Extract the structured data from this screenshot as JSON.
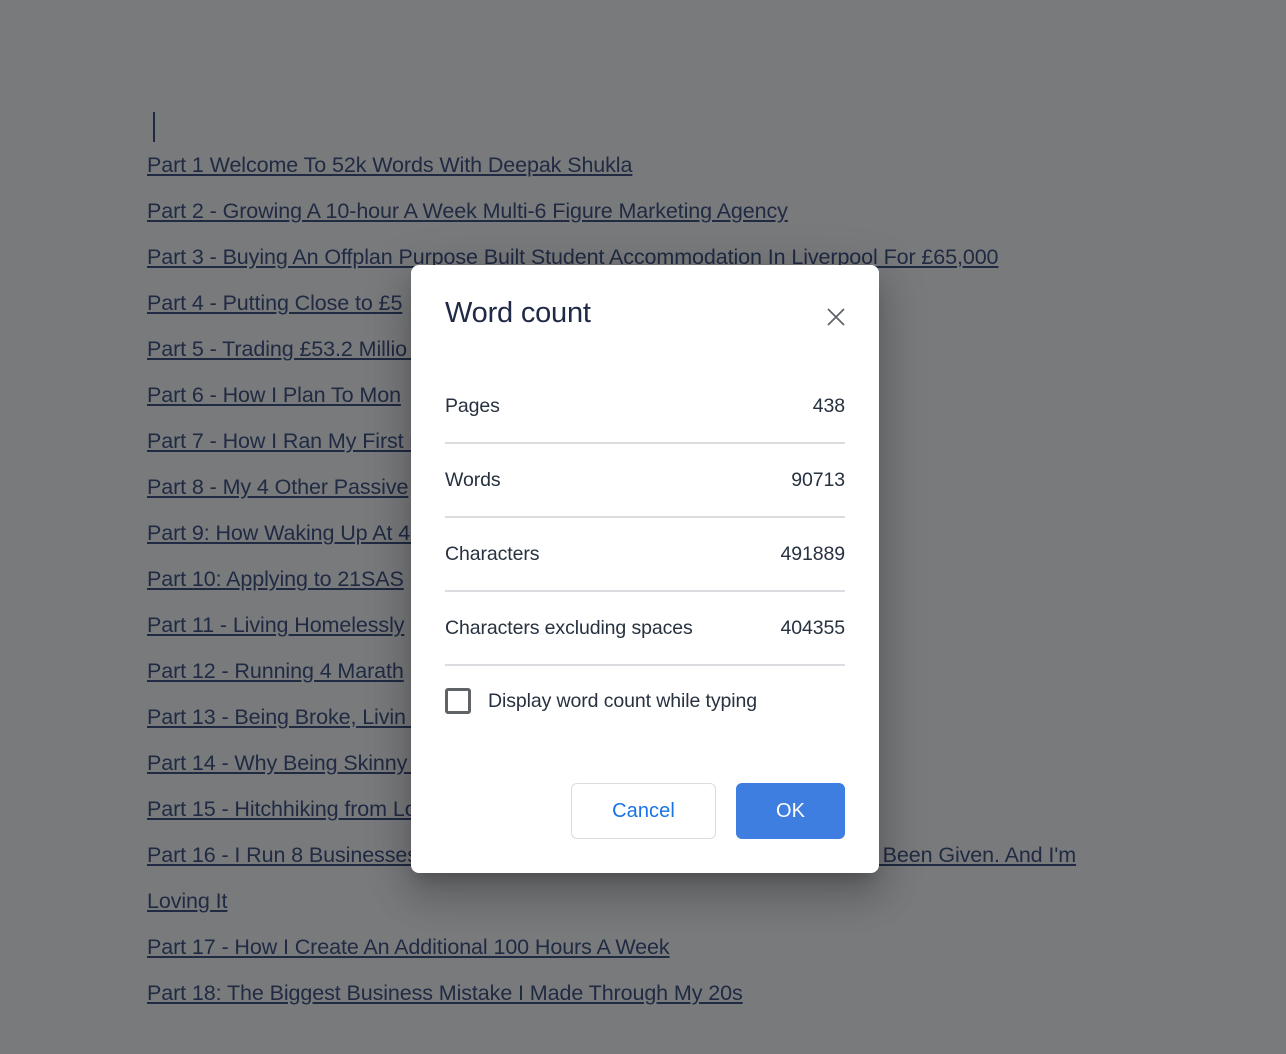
{
  "document": {
    "caret_visible": true,
    "links": [
      "Part 1 Welcome To 52k Words With Deepak Shukla",
      "Part 2 - Growing A 10-hour A Week Multi-6 Figure Marketing Agency",
      "Part 3 - Buying An Offplan Purpose Built Student Accommodation In Liverpool For £65,000",
      "Part 4 - Putting Close to £5                                                  ",
      "Part 5 - Trading £53.2 Millio                                             sh",
      "Part 6 - How I Plan To Mon                                             ",
      "Part 7 - How I Ran My First                                       ning 3 miles",
      "Part 8 - My 4 Other Passive                                        ",
      "Part 9: How Waking Up At 4                                        My Life",
      "Part 10: Applying to 21SAS                                       ",
      "Part 11 - Living Homelessly                                       ",
      "Part 12 - Running 4 Marath                                        ",
      "Part 13 - Being Broke, Livin                                            On An Estate In London",
      "Part 14 - Why Being Skinny                                           e Best Thing That Ever Happened To Me",
      "Part 15 - Hitchhiking from London to Estonia, Tallinn For A Stag Do",
      "Part 16 - I Run 8 Businesses At Once. It's The Opposite Of All The Advice I've Been Given. And I'm Loving It",
      "Part 17 - How I Create An Additional 100 Hours A Week",
      "Part 18: The Biggest Business Mistake I Made Through My 20s"
    ]
  },
  "dialog": {
    "title": "Word count",
    "close_icon": "close-icon",
    "stats": [
      {
        "label": "Pages",
        "value": "438"
      },
      {
        "label": "Words",
        "value": "90713"
      },
      {
        "label": "Characters",
        "value": "491889"
      },
      {
        "label": "Characters excluding spaces",
        "value": "404355"
      }
    ],
    "checkbox": {
      "label": "Display word count while typing",
      "checked": false
    },
    "buttons": {
      "cancel": "Cancel",
      "ok": "OK"
    }
  },
  "colors": {
    "accent_blue": "#3d7ee0",
    "link_blue": "#1a73e8",
    "doc_link": "#21386e",
    "scrim": "rgba(32,33,36,0.60)",
    "divider": "#dadce0"
  }
}
